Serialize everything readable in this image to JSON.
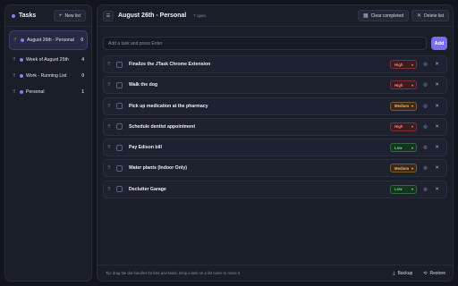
{
  "sidebar": {
    "title": "Tasks",
    "new_list_label": "New list",
    "new_list_icon": "+",
    "items": [
      {
        "label": "August 26th - Personal",
        "count": "0",
        "color": "#8b7cf6",
        "active": true
      },
      {
        "label": "Week of August 25th",
        "count": "4",
        "color": "#8b7cf6",
        "active": false
      },
      {
        "label": "Work - Running List",
        "count": "0",
        "color": "#8b7cf6",
        "active": false
      },
      {
        "label": "Personal",
        "count": "1",
        "color": "#8b7cf6",
        "active": false
      }
    ]
  },
  "main": {
    "title": "August 26th - Personal",
    "open_count": "7 open",
    "clear_completed_label": "Clear completed",
    "delete_list_label": "Delete list",
    "input": {
      "placeholder": "Add a task and press Enter",
      "value": ""
    },
    "add_label": "Add",
    "tasks": [
      {
        "title": "Finalize the JTask Chrome Extension",
        "priority": "High"
      },
      {
        "title": "Walk the dog",
        "priority": "High"
      },
      {
        "title": "Pick up medication at the pharmacy",
        "priority": "Medium"
      },
      {
        "title": "Schedule dentist appointment",
        "priority": "High"
      },
      {
        "title": "Pay Edison bill",
        "priority": "Low"
      },
      {
        "title": "Water plants (Indoor Only)",
        "priority": "Medium"
      },
      {
        "title": "Declutter Garage",
        "priority": "Low"
      }
    ],
    "footer_tip": "Tip: drag the dot handles for lists and tasks. Drop a task on a list name to move it.",
    "backup_label": "Backup",
    "restore_label": "Restore"
  },
  "priority_colors": {
    "High": {
      "text": "#ff7a7a",
      "bg": "#3b1c22",
      "border": "#7a2e38"
    },
    "Medium": {
      "text": "#f5b35c",
      "bg": "#3a2a17",
      "border": "#7a5a26"
    },
    "Low": {
      "text": "#6fd48a",
      "bg": "#17321f",
      "border": "#2d6a3d"
    }
  },
  "accent": "#7c6cf0"
}
